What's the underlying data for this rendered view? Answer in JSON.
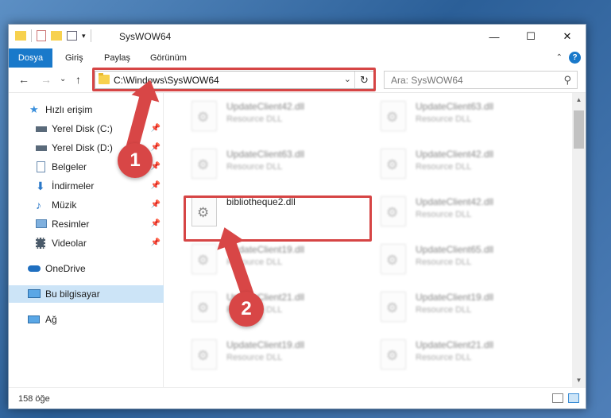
{
  "window": {
    "title": "SysWOW64",
    "controls": {
      "minimize": "—",
      "maximize": "☐",
      "close": "✕"
    }
  },
  "ribbon": {
    "tabs": [
      "Dosya",
      "Giriş",
      "Paylaş",
      "Görünüm"
    ],
    "help": "?",
    "collapse": "⌃"
  },
  "navbar": {
    "back": "←",
    "forward": "→",
    "recent": "⌄",
    "up": "↑",
    "address": "C:\\Windows\\SysWOW64",
    "dropdown": "⌄",
    "refresh": "↻",
    "search_placeholder": "Ara: SysWOW64",
    "search_icon": "⚲"
  },
  "sidebar": {
    "items": [
      {
        "label": "Hızlı erişim",
        "icon": "star-icon",
        "pinned": false
      },
      {
        "label": "Yerel Disk (C:)",
        "icon": "drive-icon",
        "pinned": true
      },
      {
        "label": "Yerel Disk (D:)",
        "icon": "drive-icon",
        "pinned": true
      },
      {
        "label": "Belgeler",
        "icon": "documents-icon",
        "pinned": true
      },
      {
        "label": "İndirmeler",
        "icon": "download-icon",
        "pinned": true
      },
      {
        "label": "Müzik",
        "icon": "music-icon",
        "pinned": true
      },
      {
        "label": "Resimler",
        "icon": "pictures-icon",
        "pinned": true
      },
      {
        "label": "Videolar",
        "icon": "video-icon",
        "pinned": true
      },
      {
        "label": "OneDrive",
        "icon": "cloud-icon",
        "pinned": false
      },
      {
        "label": "Bu bilgisayar",
        "icon": "computer-icon",
        "pinned": false,
        "selected": true
      },
      {
        "label": "Ağ",
        "icon": "network-icon",
        "pinned": false
      }
    ],
    "pin_glyph": "📌"
  },
  "files": [
    {
      "name": "UpdateClient42.dll",
      "type": "Resource DLL",
      "blurred": true
    },
    {
      "name": "UpdateClient63.dll",
      "type": "Resource DLL",
      "blurred": true
    },
    {
      "name": "UpdateClient63.dll",
      "type": "Resource DLL",
      "blurred": true
    },
    {
      "name": "UpdateClient42.dll",
      "type": "Resource DLL",
      "blurred": true
    },
    {
      "name": "bibliotheque2.dll",
      "type": "",
      "blurred": false,
      "highlighted": true
    },
    {
      "name": "UpdateClient42.dll",
      "type": "Resource DLL",
      "blurred": true
    },
    {
      "name": "UpdateClient19.dll",
      "type": "Resource DLL",
      "blurred": true
    },
    {
      "name": "UpdateClient65.dll",
      "type": "Resource DLL",
      "blurred": true
    },
    {
      "name": "UpdateClient21.dll",
      "type": "Resource DLL",
      "blurred": true
    },
    {
      "name": "UpdateClient19.dll",
      "type": "Resource DLL",
      "blurred": true
    },
    {
      "name": "UpdateClient19.dll",
      "type": "Resource DLL",
      "blurred": true
    },
    {
      "name": "UpdateClient21.dll",
      "type": "Resource DLL",
      "blurred": true
    }
  ],
  "status": {
    "count": "158 öğe"
  },
  "annotations": {
    "step1": "1",
    "step2": "2",
    "color": "#d84646"
  }
}
